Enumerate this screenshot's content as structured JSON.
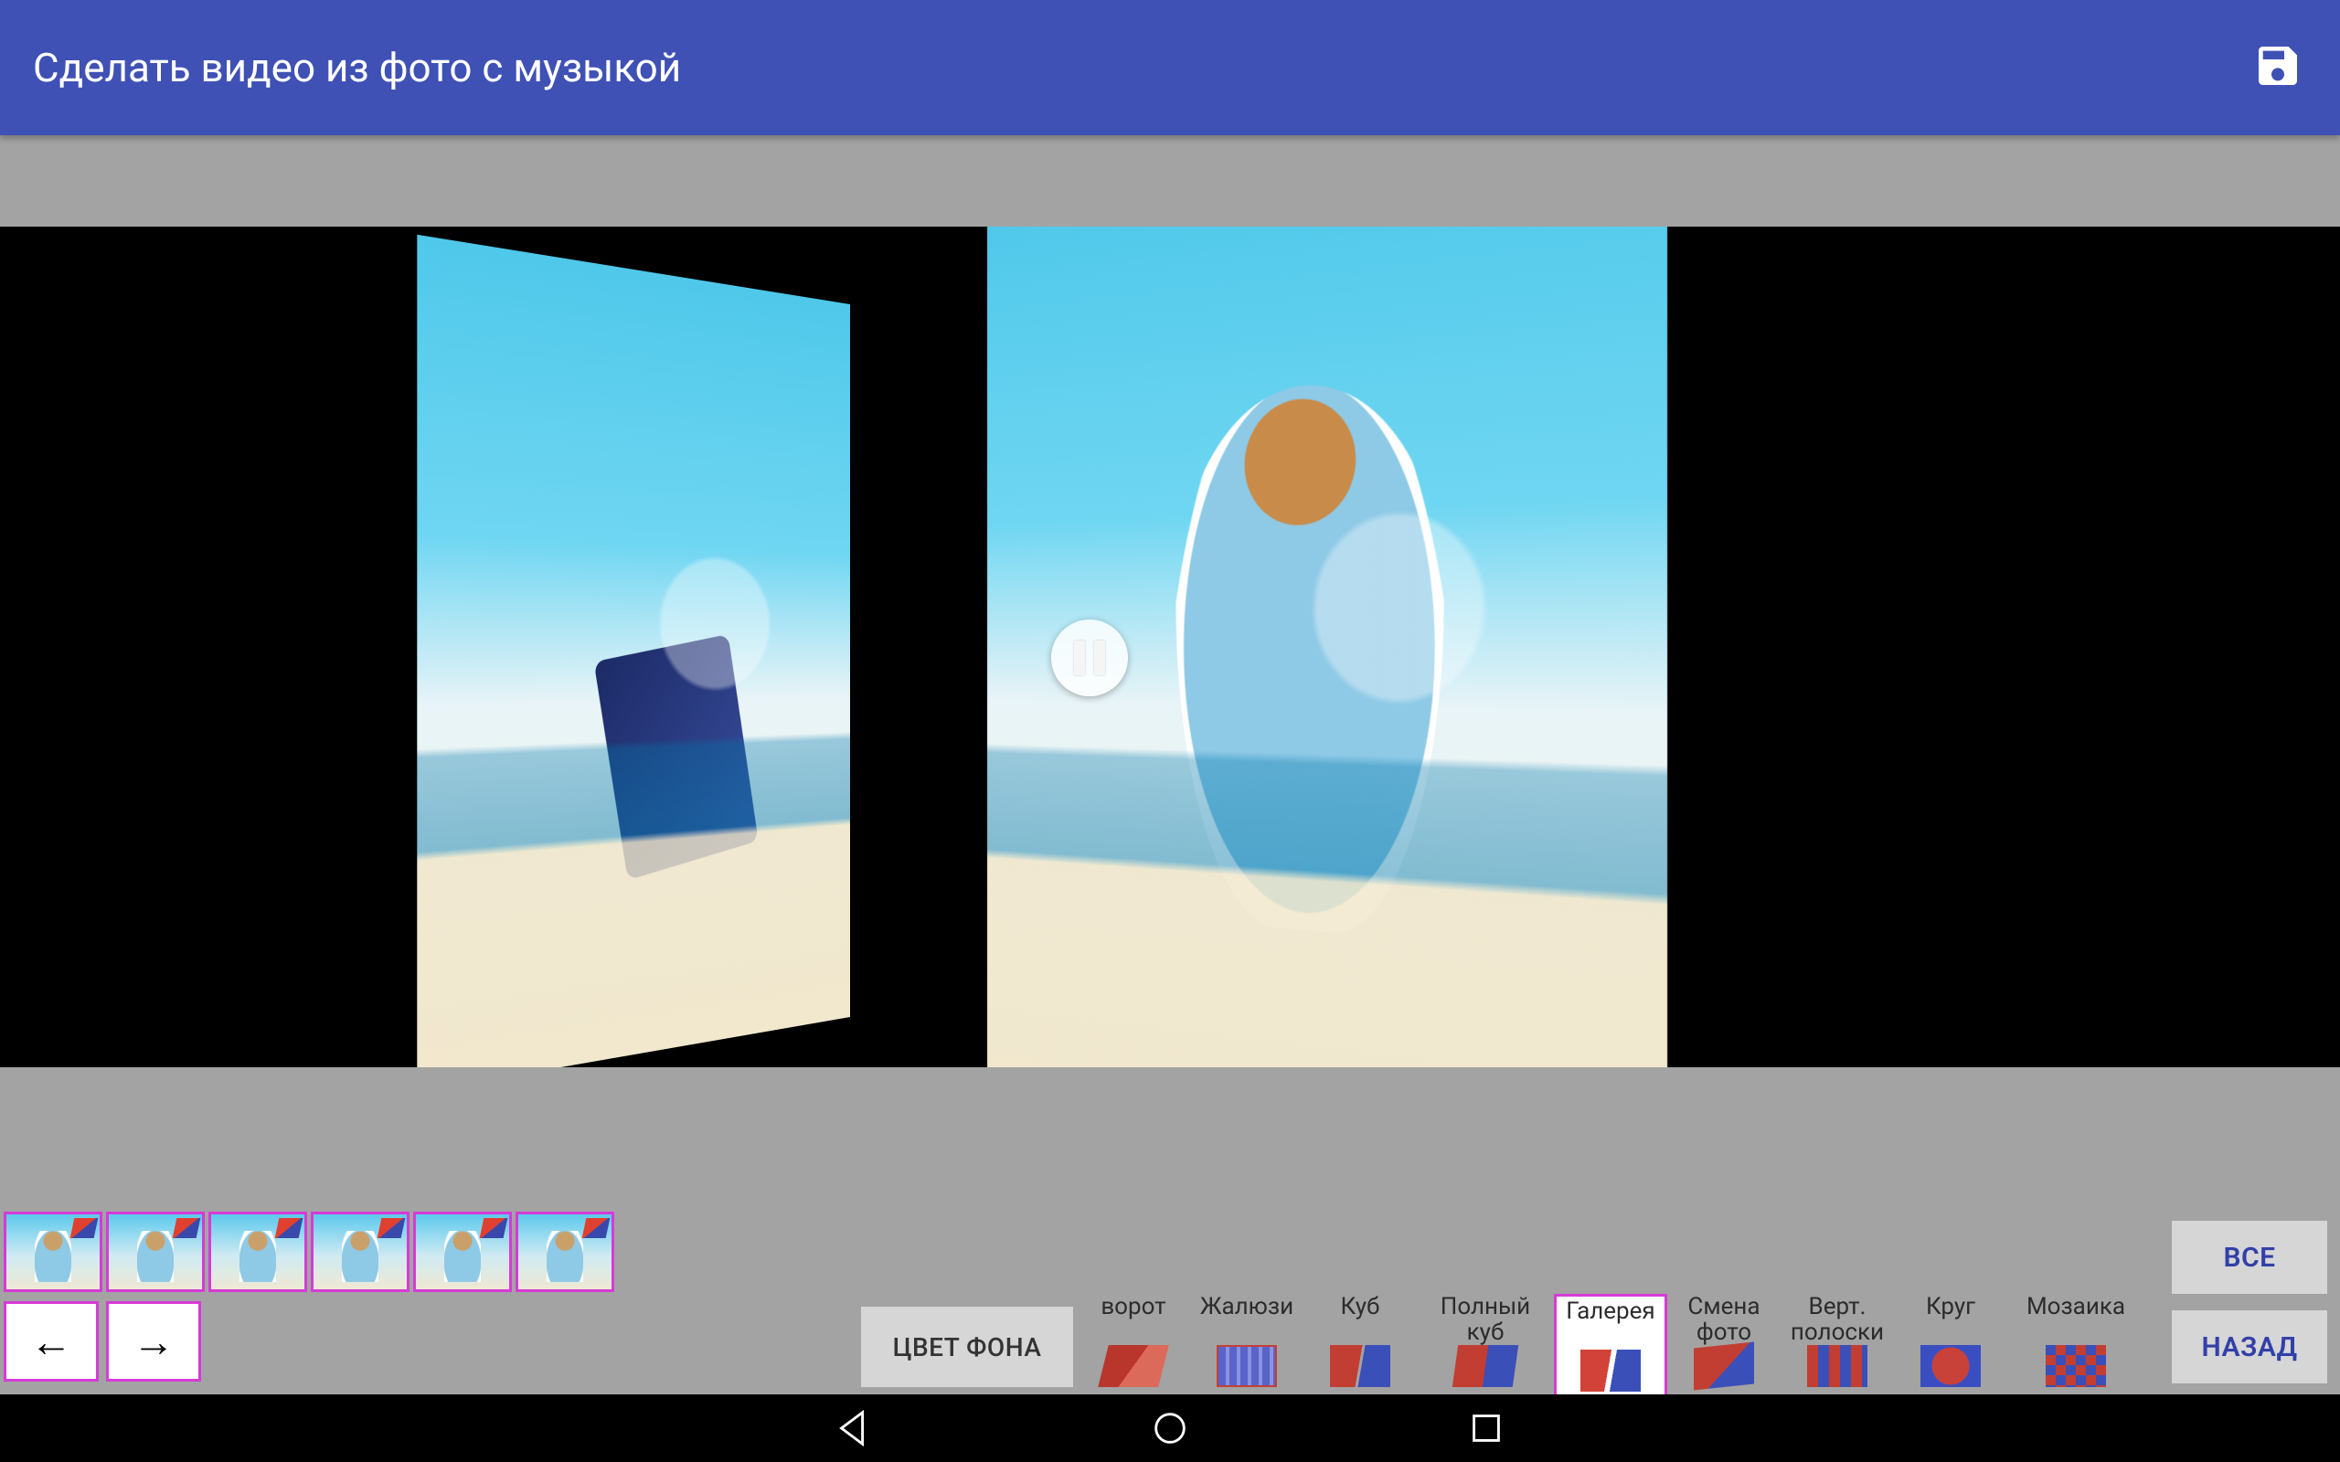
{
  "appbar": {
    "title": "Сделать видео из фото с музыкой"
  },
  "buttons": {
    "bg_color": "ЦВЕТ ФОНА",
    "all": "ВСЕ",
    "back": "НАЗАД"
  },
  "arrows": {
    "left": "←",
    "right": "→"
  },
  "effects": [
    {
      "key": "rotate",
      "label": "ворот",
      "icon": "ic-rotate"
    },
    {
      "key": "blinds",
      "label": "Жалюзи",
      "icon": "ic-blinds"
    },
    {
      "key": "cube",
      "label": "Куб",
      "icon": "ic-cube"
    },
    {
      "key": "fullcube",
      "label": "Полный\nкуб",
      "icon": "ic-fullcube",
      "wide": true
    },
    {
      "key": "gallery",
      "label": "Галерея",
      "icon": "ic-gallery",
      "selected": true
    },
    {
      "key": "change",
      "label": "Смена\nфото",
      "icon": "ic-change"
    },
    {
      "key": "vstripes",
      "label": "Верт.\nполоски",
      "icon": "ic-vstripes"
    },
    {
      "key": "circle",
      "label": "Круг",
      "icon": "ic-circle"
    },
    {
      "key": "mosaic",
      "label": "Мозаика",
      "icon": "ic-mosaic",
      "wide": true
    }
  ],
  "thumbnail_count": 6
}
